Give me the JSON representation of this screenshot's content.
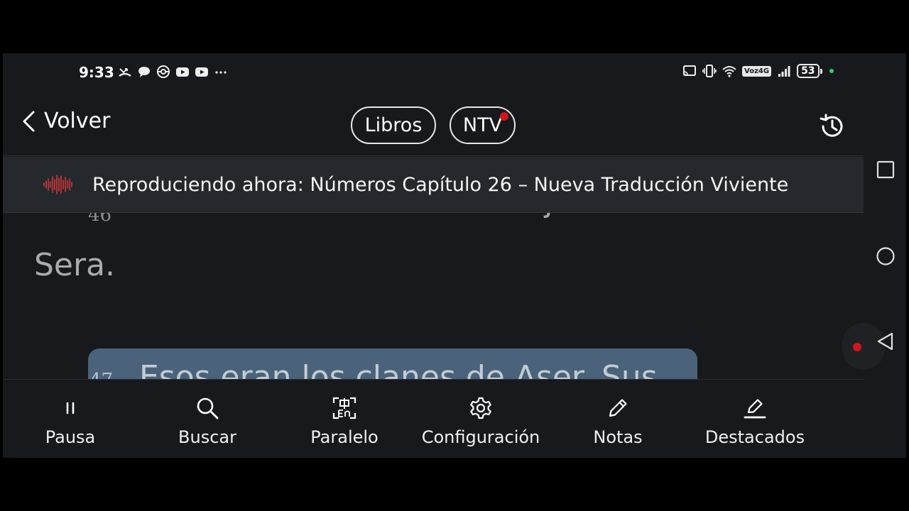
{
  "status_bar": {
    "time": "9:33",
    "left_icons": [
      "missed-call-icon",
      "chat-bubble-icon",
      "pokeball-icon",
      "youtube-icon",
      "youtube-icon",
      "more-dots-icon"
    ],
    "right_icons": [
      "cast-icon",
      "vibrate-icon",
      "wifi-icon",
      "volte-badge",
      "signal-icon",
      "battery"
    ],
    "network": "Voz4G",
    "battery": "53"
  },
  "header": {
    "back_label": "Volver",
    "books_label": "Libros",
    "version_label": "NTV"
  },
  "now_playing": {
    "text": "Reproduciendo ahora: Números Capítulo 26 – Nueva Traducción Viviente"
  },
  "reader": {
    "verses": [
      {
        "number": "46",
        "text": "Aser también tenía una hija llamada",
        "continuation": "Sera."
      },
      {
        "number": "47",
        "text": "Esos eran los clanes de Aser. Sus"
      }
    ]
  },
  "toolbar": {
    "items": [
      {
        "label": "Pausa",
        "icon": "pause-icon"
      },
      {
        "label": "Buscar",
        "icon": "search-icon"
      },
      {
        "label": "Paralelo",
        "icon": "translate-icon"
      },
      {
        "label": "Configuración",
        "icon": "gear-icon"
      },
      {
        "label": "Notas",
        "icon": "pencil-icon"
      },
      {
        "label": "Destacados",
        "icon": "highlighter-icon"
      }
    ]
  },
  "colors": {
    "background": "#17191d",
    "now_playing_bg": "#25282c",
    "highlight": "#4a637a",
    "accent_red": "#d0161c"
  }
}
